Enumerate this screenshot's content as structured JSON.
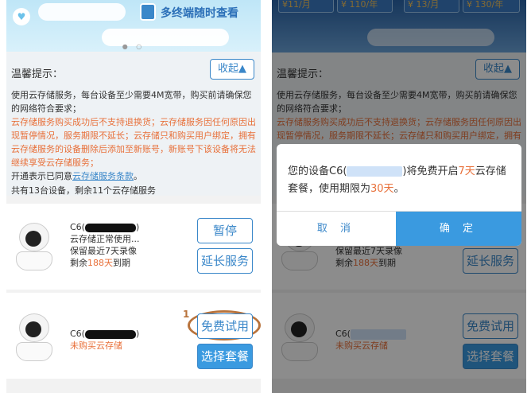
{
  "left": {
    "banner": {
      "text": "多终端随时查看",
      "dots": "● ○"
    },
    "notice": {
      "title": "温馨提示：",
      "collapse_label": "收起▲",
      "line1": "使用云存储服务，每台设备至少需要4M宽带，购买前请确保您的网络符合要求；",
      "line2": "云存储服务购买成功后不支持退换货；云存储服务因任何原因出现暂停情况，服务期限不延长；云存储只和购买用户绑定，拥有云存储服务的设备删除后添加至新账号，新账号下该设备将无法继续享受云存储服务；",
      "line3_prefix": "开通表示已同意",
      "line3_link": "云存储服务条款",
      "line3_suffix": "。",
      "line4": "共有13台设备，剩余11个云存储服务"
    },
    "devices": [
      {
        "name": "C6(",
        "name_suffix": ")",
        "status": "云存储正常使用...",
        "retention": "保留最近7天录像",
        "remaining_prefix": "剩余",
        "remaining_days": "188天",
        "remaining_suffix": "到期",
        "btn1": "暂停",
        "btn2": "延长服务"
      },
      {
        "name": "C6(",
        "name_suffix": ")",
        "status": "未购买云存储",
        "annot": "1",
        "btn1": "免费试用",
        "btn2": "选择套餐"
      }
    ]
  },
  "right": {
    "top_pills": [
      "¥11/月",
      "¥ 110/年",
      "¥ 13/月",
      "¥ 130/年"
    ],
    "notice_title": "温馨提示：",
    "collapse_label": "收起▲",
    "modal": {
      "text_1": "您的设备C6(",
      "text_2": ")将免费开启",
      "days7": "7天",
      "text_3": "云存储套餐，使用期限为",
      "days30": "30天",
      "text_4": "。",
      "cancel": "取 消",
      "confirm": "确 定"
    }
  }
}
